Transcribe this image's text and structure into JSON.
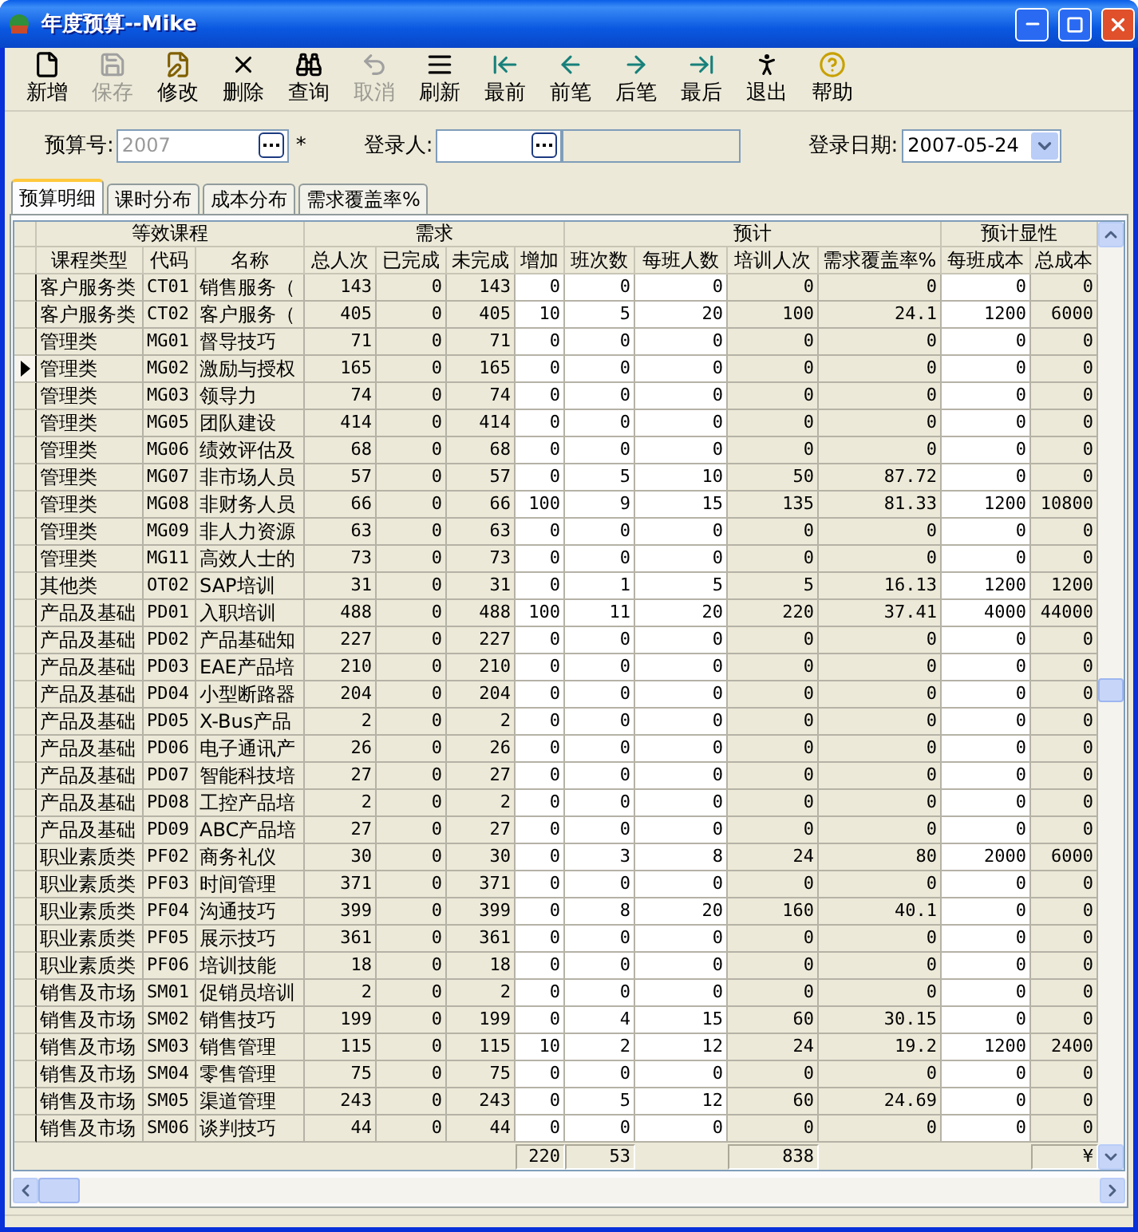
{
  "window": {
    "title": "年度预算--Mike"
  },
  "toolbar": [
    {
      "label": "新增",
      "disabled": false
    },
    {
      "label": "保存",
      "disabled": true
    },
    {
      "label": "修改",
      "disabled": false
    },
    {
      "label": "删除",
      "disabled": false
    },
    {
      "label": "查询",
      "disabled": false
    },
    {
      "label": "取消",
      "disabled": true
    },
    {
      "label": "刷新",
      "disabled": false
    },
    {
      "label": "最前",
      "disabled": false
    },
    {
      "label": "前笔",
      "disabled": false
    },
    {
      "label": "后笔",
      "disabled": false
    },
    {
      "label": "最后",
      "disabled": false
    },
    {
      "label": "退出",
      "disabled": false
    },
    {
      "label": "帮助",
      "disabled": false
    }
  ],
  "form": {
    "budget_no": {
      "label": "预算号:",
      "value": "2007",
      "disabled": true,
      "required_mark": "*"
    },
    "registrant": {
      "label": "登录人:"
    },
    "date": {
      "label": "登录日期:",
      "value": "2007-05-24"
    }
  },
  "tabs": [
    {
      "label": "预算明细",
      "selected": true
    },
    {
      "label": "课时分布",
      "selected": false
    },
    {
      "label": "成本分布",
      "selected": false
    },
    {
      "label": "需求覆盖率%",
      "selected": false
    }
  ],
  "table": {
    "groups": [
      {
        "label": "等效课程",
        "columns": [
          {
            "label": "课程类型",
            "kind": "computed"
          },
          {
            "label": "代码",
            "kind": "computed"
          },
          {
            "label": "名称",
            "kind": "computed"
          }
        ]
      },
      {
        "label": "需求",
        "columns": [
          {
            "label": "总人次",
            "kind": "computed"
          },
          {
            "label": "已完成",
            "kind": "computed"
          },
          {
            "label": "未完成",
            "kind": "computed"
          },
          {
            "label": "增加",
            "kind": "input",
            "total": "220"
          }
        ]
      },
      {
        "label": "预计",
        "columns": [
          {
            "label": "班次数",
            "kind": "input",
            "total": "53"
          },
          {
            "label": "每班人数",
            "kind": "input"
          },
          {
            "label": "培训人次",
            "kind": "computed",
            "total": "838"
          },
          {
            "label": "需求覆盖率%",
            "kind": "computed"
          }
        ]
      },
      {
        "label": "预计显性",
        "columns": [
          {
            "label": "每班成本",
            "kind": "input"
          },
          {
            "label": "总成本",
            "kind": "computed",
            "total": "¥"
          }
        ]
      }
    ],
    "rows": [
      {
        "selected": false,
        "cells": [
          "客户服务类",
          "CT01",
          "销售服务（",
          "143",
          "0",
          "143",
          "0",
          "0",
          "0",
          "0",
          "0",
          "0",
          "0"
        ]
      },
      {
        "selected": false,
        "cells": [
          "客户服务类",
          "CT02",
          "客户服务（",
          "405",
          "0",
          "405",
          "10",
          "5",
          "20",
          "100",
          "24.1",
          "1200",
          "6000"
        ]
      },
      {
        "selected": false,
        "cells": [
          "管理类",
          "MG01",
          "督导技巧",
          "71",
          "0",
          "71",
          "0",
          "0",
          "0",
          "0",
          "0",
          "0",
          "0"
        ]
      },
      {
        "selected": true,
        "cells": [
          "管理类",
          "MG02",
          "激励与授权",
          "165",
          "0",
          "165",
          "0",
          "0",
          "0",
          "0",
          "0",
          "0",
          "0"
        ]
      },
      {
        "selected": false,
        "cells": [
          "管理类",
          "MG03",
          "领导力",
          "74",
          "0",
          "74",
          "0",
          "0",
          "0",
          "0",
          "0",
          "0",
          "0"
        ]
      },
      {
        "selected": false,
        "cells": [
          "管理类",
          "MG05",
          "团队建设",
          "414",
          "0",
          "414",
          "0",
          "0",
          "0",
          "0",
          "0",
          "0",
          "0"
        ]
      },
      {
        "selected": false,
        "cells": [
          "管理类",
          "MG06",
          "绩效评估及",
          "68",
          "0",
          "68",
          "0",
          "0",
          "0",
          "0",
          "0",
          "0",
          "0"
        ]
      },
      {
        "selected": false,
        "cells": [
          "管理类",
          "MG07",
          "非市场人员",
          "57",
          "0",
          "57",
          "0",
          "5",
          "10",
          "50",
          "87.72",
          "0",
          "0"
        ]
      },
      {
        "selected": false,
        "cells": [
          "管理类",
          "MG08",
          "非财务人员",
          "66",
          "0",
          "66",
          "100",
          "9",
          "15",
          "135",
          "81.33",
          "1200",
          "10800"
        ]
      },
      {
        "selected": false,
        "cells": [
          "管理类",
          "MG09",
          "非人力资源",
          "63",
          "0",
          "63",
          "0",
          "0",
          "0",
          "0",
          "0",
          "0",
          "0"
        ]
      },
      {
        "selected": false,
        "cells": [
          "管理类",
          "MG11",
          "高效人士的",
          "73",
          "0",
          "73",
          "0",
          "0",
          "0",
          "0",
          "0",
          "0",
          "0"
        ]
      },
      {
        "selected": false,
        "cells": [
          "其他类",
          "OT02",
          "SAP培训",
          "31",
          "0",
          "31",
          "0",
          "1",
          "5",
          "5",
          "16.13",
          "1200",
          "1200"
        ]
      },
      {
        "selected": false,
        "cells": [
          "产品及基础",
          "PD01",
          "入职培训",
          "488",
          "0",
          "488",
          "100",
          "11",
          "20",
          "220",
          "37.41",
          "4000",
          "44000"
        ]
      },
      {
        "selected": false,
        "cells": [
          "产品及基础",
          "PD02",
          "产品基础知",
          "227",
          "0",
          "227",
          "0",
          "0",
          "0",
          "0",
          "0",
          "0",
          "0"
        ]
      },
      {
        "selected": false,
        "cells": [
          "产品及基础",
          "PD03",
          "EAE产品培",
          "210",
          "0",
          "210",
          "0",
          "0",
          "0",
          "0",
          "0",
          "0",
          "0"
        ]
      },
      {
        "selected": false,
        "cells": [
          "产品及基础",
          "PD04",
          "小型断路器",
          "204",
          "0",
          "204",
          "0",
          "0",
          "0",
          "0",
          "0",
          "0",
          "0"
        ]
      },
      {
        "selected": false,
        "cells": [
          "产品及基础",
          "PD05",
          "X-Bus产品",
          "2",
          "0",
          "2",
          "0",
          "0",
          "0",
          "0",
          "0",
          "0",
          "0"
        ]
      },
      {
        "selected": false,
        "cells": [
          "产品及基础",
          "PD06",
          "电子通讯产",
          "26",
          "0",
          "26",
          "0",
          "0",
          "0",
          "0",
          "0",
          "0",
          "0"
        ]
      },
      {
        "selected": false,
        "cells": [
          "产品及基础",
          "PD07",
          "智能科技培",
          "27",
          "0",
          "27",
          "0",
          "0",
          "0",
          "0",
          "0",
          "0",
          "0"
        ]
      },
      {
        "selected": false,
        "cells": [
          "产品及基础",
          "PD08",
          "工控产品培",
          "2",
          "0",
          "2",
          "0",
          "0",
          "0",
          "0",
          "0",
          "0",
          "0"
        ]
      },
      {
        "selected": false,
        "cells": [
          "产品及基础",
          "PD09",
          "ABC产品培",
          "27",
          "0",
          "27",
          "0",
          "0",
          "0",
          "0",
          "0",
          "0",
          "0"
        ]
      },
      {
        "selected": false,
        "cells": [
          "职业素质类",
          "PF02",
          "商务礼仪",
          "30",
          "0",
          "30",
          "0",
          "3",
          "8",
          "24",
          "80",
          "2000",
          "6000"
        ]
      },
      {
        "selected": false,
        "cells": [
          "职业素质类",
          "PF03",
          "时间管理",
          "371",
          "0",
          "371",
          "0",
          "0",
          "0",
          "0",
          "0",
          "0",
          "0"
        ]
      },
      {
        "selected": false,
        "cells": [
          "职业素质类",
          "PF04",
          "沟通技巧",
          "399",
          "0",
          "399",
          "0",
          "8",
          "20",
          "160",
          "40.1",
          "0",
          "0"
        ]
      },
      {
        "selected": false,
        "cells": [
          "职业素质类",
          "PF05",
          "展示技巧",
          "361",
          "0",
          "361",
          "0",
          "0",
          "0",
          "0",
          "0",
          "0",
          "0"
        ]
      },
      {
        "selected": false,
        "cells": [
          "职业素质类",
          "PF06",
          "培训技能",
          "18",
          "0",
          "18",
          "0",
          "0",
          "0",
          "0",
          "0",
          "0",
          "0"
        ]
      },
      {
        "selected": false,
        "cells": [
          "销售及市场",
          "SM01",
          "促销员培训",
          "2",
          "0",
          "2",
          "0",
          "0",
          "0",
          "0",
          "0",
          "0",
          "0"
        ]
      },
      {
        "selected": false,
        "cells": [
          "销售及市场",
          "SM02",
          "销售技巧",
          "199",
          "0",
          "199",
          "0",
          "4",
          "15",
          "60",
          "30.15",
          "0",
          "0"
        ]
      },
      {
        "selected": false,
        "cells": [
          "销售及市场",
          "SM03",
          "销售管理",
          "115",
          "0",
          "115",
          "10",
          "2",
          "12",
          "24",
          "19.2",
          "1200",
          "2400"
        ]
      },
      {
        "selected": false,
        "cells": [
          "销售及市场",
          "SM04",
          "零售管理",
          "75",
          "0",
          "75",
          "0",
          "0",
          "0",
          "0",
          "0",
          "0",
          "0"
        ]
      },
      {
        "selected": false,
        "cells": [
          "销售及市场",
          "SM05",
          "渠道管理",
          "243",
          "0",
          "243",
          "0",
          "5",
          "12",
          "60",
          "24.69",
          "0",
          "0"
        ]
      },
      {
        "selected": false,
        "cells": [
          "销售及市场",
          "SM06",
          "谈判技巧",
          "44",
          "0",
          "44",
          "0",
          "0",
          "0",
          "0",
          "0",
          "0",
          "0"
        ]
      }
    ]
  }
}
